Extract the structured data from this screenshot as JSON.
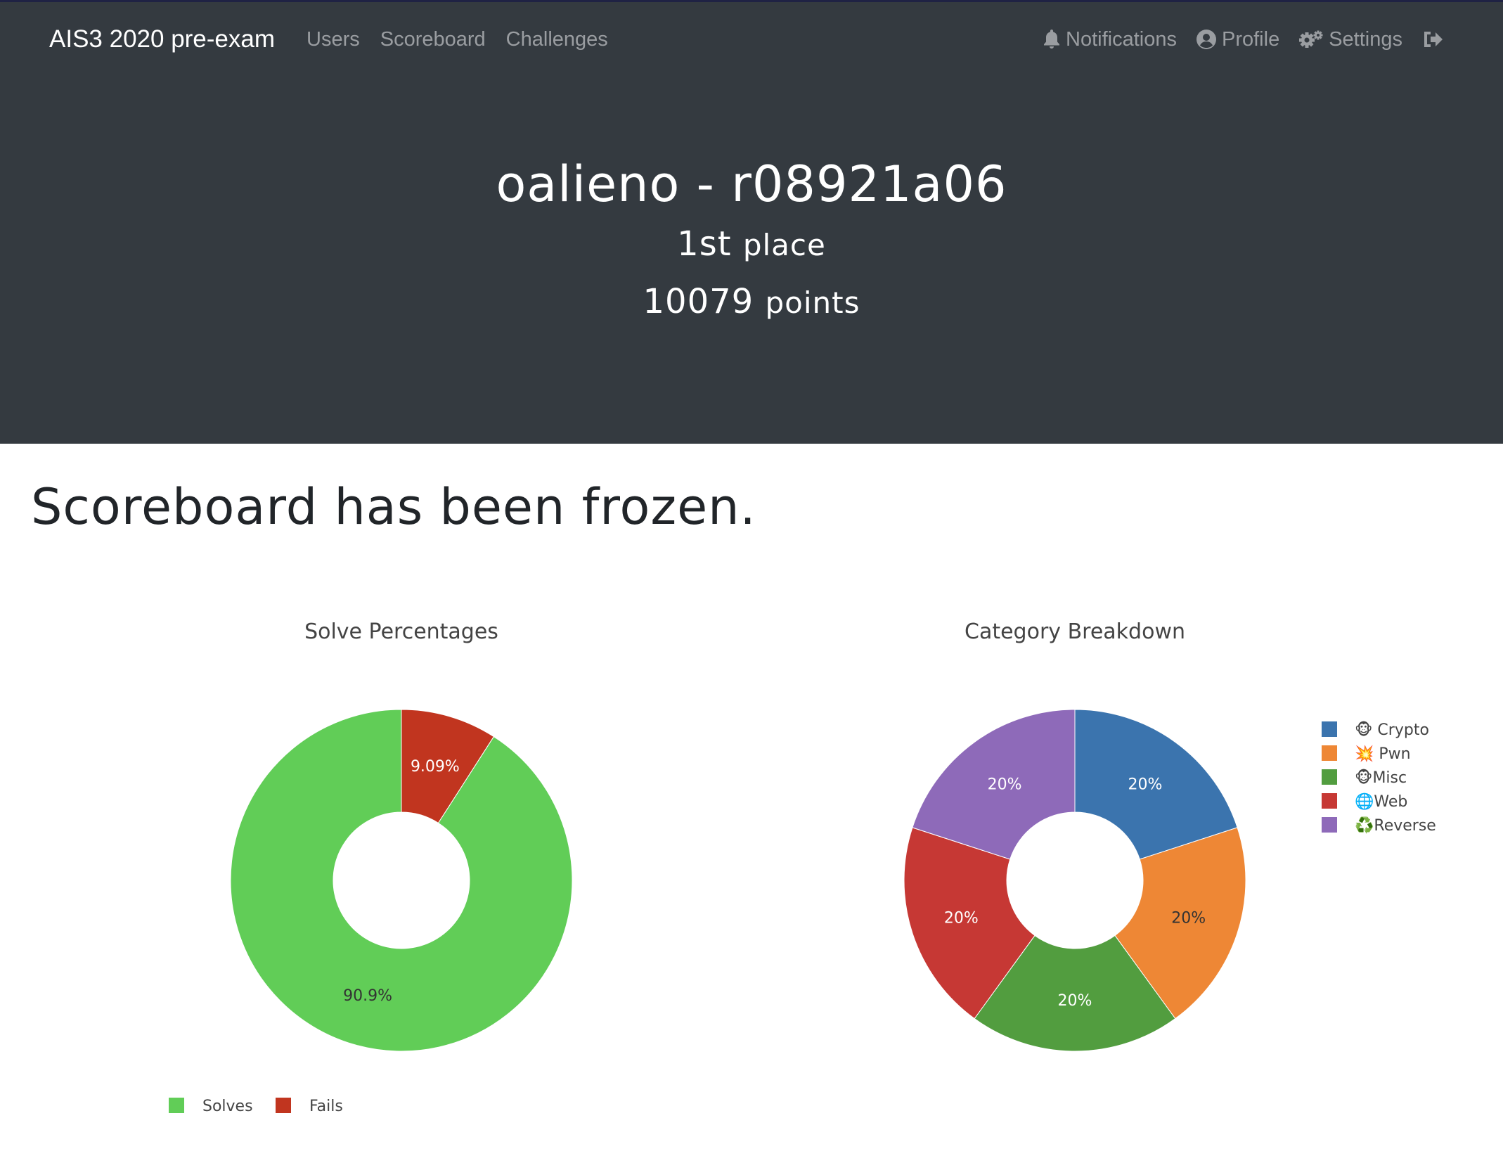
{
  "navbar": {
    "brand": "AIS3 2020 pre-exam",
    "left_links": [
      {
        "label": "Users"
      },
      {
        "label": "Scoreboard"
      },
      {
        "label": "Challenges"
      }
    ],
    "right_links": [
      {
        "label": "Notifications",
        "icon": "bell-icon"
      },
      {
        "label": "Profile",
        "icon": "user-circle-icon"
      },
      {
        "label": "Settings",
        "icon": "gears-icon"
      },
      {
        "label": "",
        "icon": "logout-icon"
      }
    ]
  },
  "jumbotron": {
    "name": "oalieno - r08921a06",
    "place_number": "1st",
    "place_label": "place",
    "points_number": "10079",
    "points_label": "points"
  },
  "notice": "Scoreboard has been frozen.",
  "colors": {
    "navbar_bg": "#343a40",
    "nav_link": "#9a9da1",
    "solves": "#61cd57",
    "fails": "#c1351f",
    "crypto": "#3b74ae",
    "pwn": "#ee8735",
    "misc": "#529d3f",
    "web": "#c63834",
    "reverse": "#8e6ab9"
  },
  "chart_data": [
    {
      "type": "pie",
      "title": "Solve Percentages",
      "categories": [
        "Solves",
        "Fails"
      ],
      "values": [
        90.9,
        9.09
      ],
      "labels": [
        "90.9%",
        "9.09%"
      ],
      "colors": [
        "#61cd57",
        "#c1351f"
      ],
      "legend": "bottom-left",
      "hole": true
    },
    {
      "type": "pie",
      "title": "Category Breakdown",
      "categories": [
        "🐵 Crypto",
        "💥 Pwn",
        "🐵Misc",
        "🌐Web",
        "♻️Reverse"
      ],
      "values": [
        20,
        20,
        20,
        20,
        20
      ],
      "labels": [
        "20%",
        "20%",
        "20%",
        "20%",
        "20%"
      ],
      "colors": [
        "#3b74ae",
        "#ee8735",
        "#529d3f",
        "#c63834",
        "#8e6ab9"
      ],
      "legend": "top-right",
      "hole": true
    }
  ]
}
